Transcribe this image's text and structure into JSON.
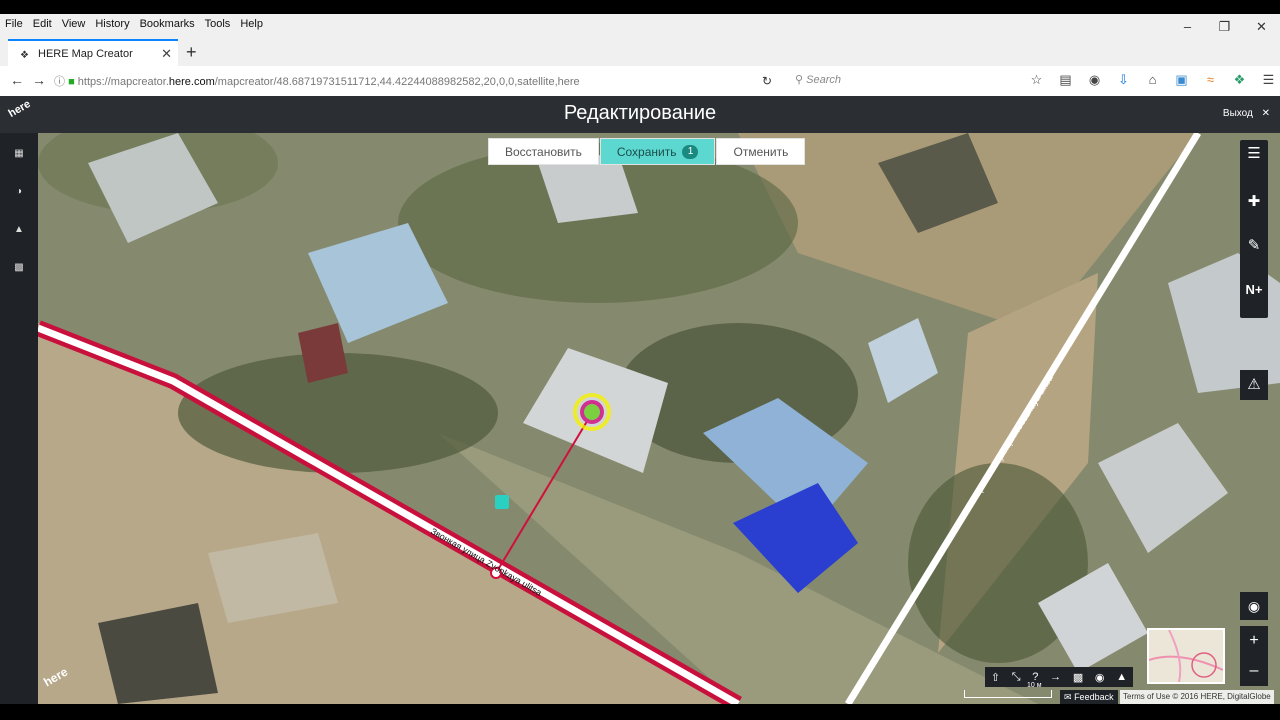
{
  "browser": {
    "menu": [
      "File",
      "Edit",
      "View",
      "History",
      "Bookmarks",
      "Tools",
      "Help"
    ],
    "tab_title": "HERE Map Creator",
    "url_prefix": "https://mapcreator.",
    "url_host": "here.com",
    "url_path": "/mapcreator/48.68719731511712,44.42244088982582,20,0,0,satellite,here",
    "search_placeholder": "Search"
  },
  "app": {
    "logo": "here",
    "title": "Редактирование",
    "exit_label": "Выход",
    "actions": {
      "restore": "Восстановить",
      "save": "Сохранить",
      "save_count": "1",
      "cancel": "Отменить"
    }
  },
  "map": {
    "street_left": "Звонкая улица Zvonkaya ulitsa",
    "street_right": "Проезжая улица Proezzhaya ulitsa",
    "scale_label": "10 м",
    "feedback": "Feedback",
    "terms": "Terms of Use © 2016 HERE, DigitalGlobe",
    "logo": "here"
  },
  "colors": {
    "accent": "#5cd8d0",
    "road": "#c8103c",
    "panel": "#1f2226"
  }
}
